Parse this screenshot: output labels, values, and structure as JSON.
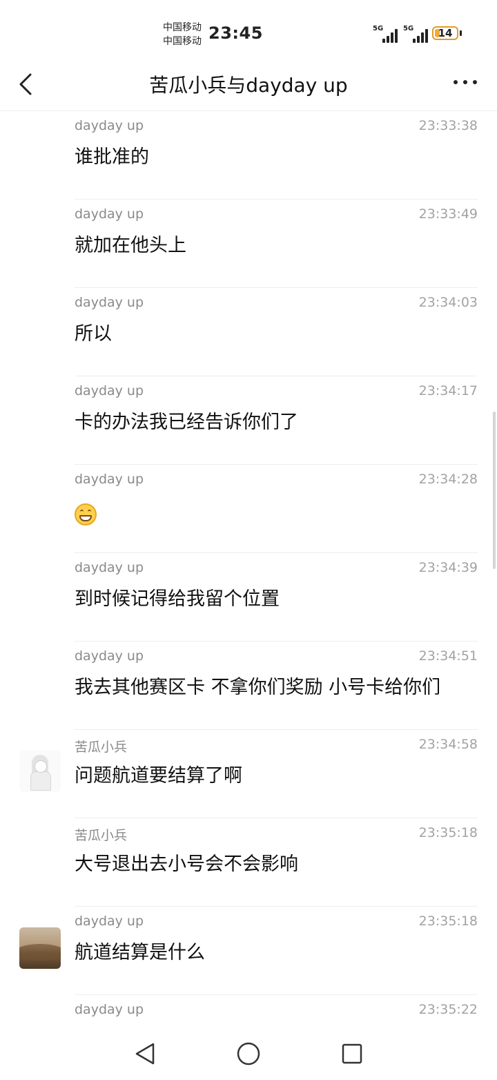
{
  "status_bar": {
    "carrier_1": "中国移动",
    "carrier_2": "中国移动",
    "time": "23:45",
    "signal_1_label": "5G",
    "signal_2_label": "5G",
    "battery_level": "14",
    "battery_color": "#f2a93b"
  },
  "header": {
    "title": "苦瓜小兵与dayday up",
    "back_icon": "chevron-left-icon",
    "more_icon": "more-horizontal-icon"
  },
  "messages": [
    {
      "sender": "dayday up",
      "time": "23:33:38",
      "text": "谁批准的"
    },
    {
      "sender": "dayday up",
      "time": "23:33:49",
      "text": "就加在他头上"
    },
    {
      "sender": "dayday up",
      "time": "23:34:03",
      "text": "所以"
    },
    {
      "sender": "dayday up",
      "time": "23:34:17",
      "text": "卡的办法我已经告诉你们了"
    },
    {
      "sender": "dayday up",
      "time": "23:34:28",
      "text": "",
      "emoji": "grinning-face-icon"
    },
    {
      "sender": "dayday up",
      "time": "23:34:39",
      "text": "到时候记得给我留个位置"
    },
    {
      "sender": "dayday up",
      "time": "23:34:51",
      "text": "我去其他赛区卡 不拿你们奖励 小号卡给你们"
    },
    {
      "sender": "苦瓜小兵",
      "time": "23:34:58",
      "text": "问题航道要结算了啊",
      "avatar": "anime-girl-avatar"
    },
    {
      "sender": "苦瓜小兵",
      "time": "23:35:18",
      "text": "大号退出去小号会不会影响"
    },
    {
      "sender": "dayday up",
      "time": "23:35:18",
      "text": "航道结算是什么",
      "avatar": "landscape-photo-avatar"
    },
    {
      "sender": "dayday up",
      "time": "23:35:22",
      "text": ""
    }
  ],
  "nav_bar": {
    "back_icon": "triangle-back-icon",
    "home_icon": "circle-home-icon",
    "recents_icon": "square-recents-icon"
  }
}
